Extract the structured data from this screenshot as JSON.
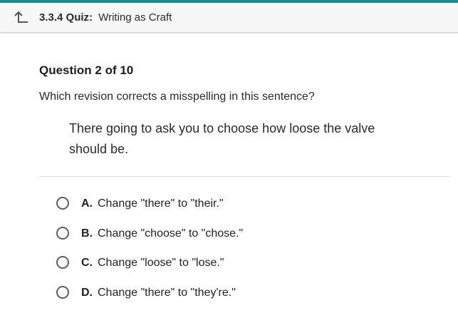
{
  "header": {
    "number": "3.3.4",
    "type": "Quiz:",
    "title": "Writing as Craft",
    "accent_color": "#1f8a8a",
    "back_icon": "back-arrow-icon"
  },
  "question": {
    "label": "Question 2 of 10",
    "prompt": "Which revision corrects a misspelling in this sentence?",
    "sentence": "There going to ask you to choose how loose the valve should be."
  },
  "options": [
    {
      "letter": "A.",
      "text": "Change \"there\" to \"their.\""
    },
    {
      "letter": "B.",
      "text": "Change \"choose\" to \"chose.\""
    },
    {
      "letter": "C.",
      "text": "Change \"loose\" to \"lose.\""
    },
    {
      "letter": "D.",
      "text": "Change \"there\" to \"they're.\""
    }
  ]
}
